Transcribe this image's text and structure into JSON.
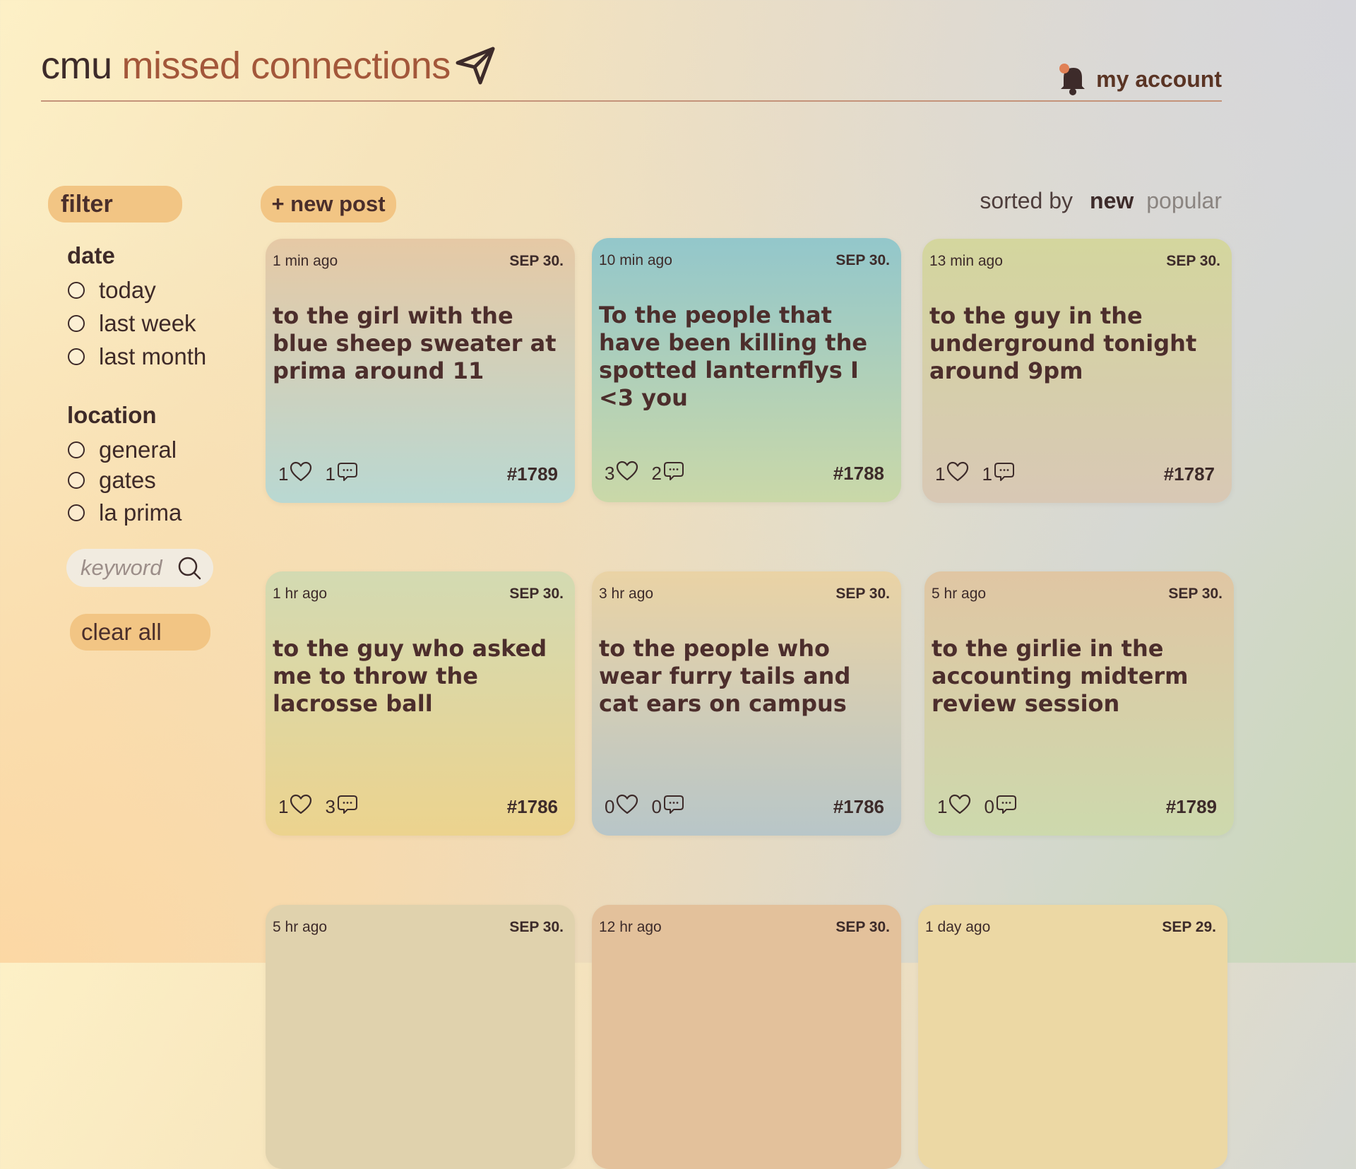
{
  "header": {
    "logo_prefix": "cmu",
    "logo_title": "missed connections",
    "account_label": "my account"
  },
  "sidebar": {
    "filter_label": "filter",
    "date_title": "date",
    "date_options": [
      "today",
      "last week",
      "last month"
    ],
    "location_title": "location",
    "location_options": [
      "general",
      "gates",
      "la prima"
    ],
    "keyword_placeholder": "keyword",
    "clear_label": "clear all"
  },
  "toolbar": {
    "new_post_label": "+ new post",
    "sorted_by_label": "sorted by",
    "sort_new": "new",
    "sort_popular": "popular"
  },
  "posts": [
    {
      "time": "1 min ago",
      "date": "SEP 30.",
      "text": "to the girl with the blue sheep sweater at prima around 11",
      "likes": "1",
      "comments": "1",
      "id": "#1789",
      "bg_top": "#e6c9a5",
      "bg_bottom": "#b9d8d2"
    },
    {
      "time": "10 min ago",
      "date": "SEP 30.",
      "text": "To the people that have been killing the spotted lanternflys I <3 you",
      "likes": "3",
      "comments": "2",
      "id": "#1788",
      "bg_top": "#93c7cb",
      "bg_bottom": "#cad8a8"
    },
    {
      "time": "13 min ago",
      "date": "SEP 30.",
      "text": "to the guy in the underground tonight around 9pm",
      "likes": "1",
      "comments": "1",
      "id": "#1787",
      "bg_top": "#d4d69e",
      "bg_bottom": "#d8c8b5"
    },
    {
      "time": "1 hr ago",
      "date": "SEP 30.",
      "text": "to the guy who asked me to throw the lacrosse ball",
      "likes": "1",
      "comments": "3",
      "id": "#1786",
      "bg_top": "#d3dab2",
      "bg_bottom": "#ecd38e"
    },
    {
      "time": "3 hr ago",
      "date": "SEP 30.",
      "text": "to the people who wear furry tails and cat ears on campus",
      "likes": "0",
      "comments": "0",
      "id": "#1786",
      "bg_top": "#ead3a5",
      "bg_bottom": "#b8c6c8"
    },
    {
      "time": "5 hr ago",
      "date": "SEP 30.",
      "text": "to the girlie in the accounting midterm review session",
      "likes": "1",
      "comments": "0",
      "id": "#1789",
      "bg_top": "#e0c6a3",
      "bg_bottom": "#cdd9ad"
    },
    {
      "time": "5 hr ago",
      "date": "SEP 30.",
      "text": "",
      "likes": "",
      "comments": "",
      "id": "",
      "bg_top": "#e0d2ad",
      "bg_bottom": "#e0d2ad"
    },
    {
      "time": "12 hr ago",
      "date": "SEP 30.",
      "text": "",
      "likes": "",
      "comments": "",
      "id": "",
      "bg_top": "#e3c19b",
      "bg_bottom": "#e3c19b"
    },
    {
      "time": "1 day ago",
      "date": "SEP 29.",
      "text": "",
      "likes": "",
      "comments": "",
      "id": "",
      "bg_top": "#ecd8a4",
      "bg_bottom": "#ecd8a4"
    }
  ],
  "colors": {
    "accent": "#f2c584",
    "brand": "#a3573a",
    "text_dark": "#3d2b2a"
  },
  "icons": [
    "paper-plane-icon",
    "bell-icon",
    "search-icon",
    "heart-icon",
    "comment-icon"
  ]
}
